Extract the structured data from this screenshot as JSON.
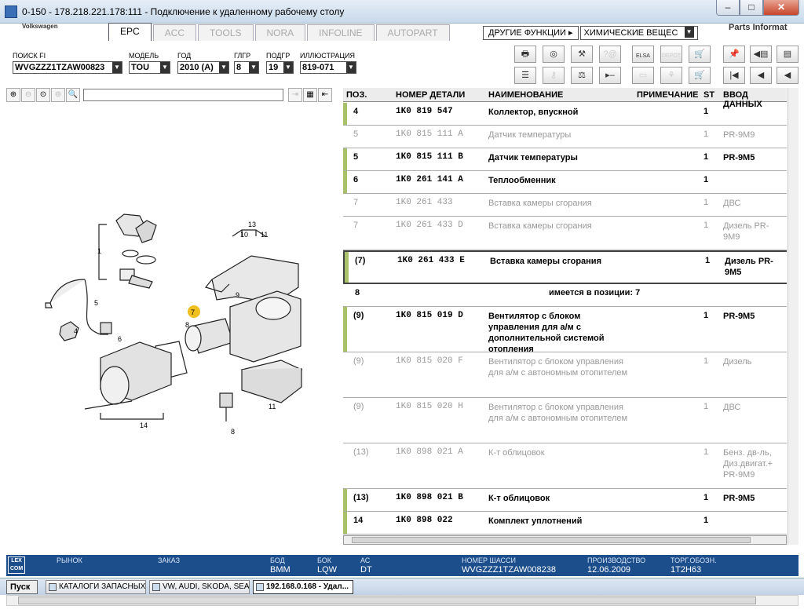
{
  "window": {
    "title": "0-150 - 178.218.221.178:111 - Подключение к удаленному рабочему столу",
    "min": "–",
    "max": "□",
    "close": "✕"
  },
  "app": {
    "brand": "Volkswagen",
    "parts_info": "Parts Informat"
  },
  "tabs": [
    {
      "label": "EPC",
      "active": true
    },
    {
      "label": "ACC"
    },
    {
      "label": "TOOLS"
    },
    {
      "label": "NORA"
    },
    {
      "label": "INFOLINE"
    },
    {
      "label": "AUTOPART"
    }
  ],
  "functions": {
    "other": "ДРУГИЕ ФУНКЦИИ ▸",
    "chem": "ХИМИЧЕСКИЕ ВЕЩЕС"
  },
  "filters": {
    "vin": {
      "label": "ПОИСК FI",
      "value": "WVGZZZ1TZAW00823"
    },
    "model": {
      "label": "МОДЕЛЬ",
      "value": "TOU"
    },
    "year": {
      "label": "ГОД",
      "value": "2010 (A)"
    },
    "mg": {
      "label": "ГЛГР",
      "value": "8"
    },
    "sg": {
      "label": "ПОДГР",
      "value": "19"
    },
    "ill": {
      "label": "ИЛЛЮСТРАЦИЯ",
      "value": "819-071"
    }
  },
  "toolbar": {
    "elsa": "ELSA",
    "depot": "DEPOT"
  },
  "table": {
    "headers": {
      "pos": "ПОЗ.",
      "pn": "НОМЕР ДЕТАЛИ",
      "name": "НАИМЕНОВАНИЕ",
      "note": "ПРИМЕЧАНИЕ",
      "st": "ST",
      "data": "ВВОД ДАННЫХ"
    },
    "rows": [
      {
        "pos": "4",
        "pn": "1K0 819 547",
        "name": "Коллектор, впускной",
        "st": "1",
        "data": ""
      },
      {
        "pos": "5",
        "pn": "1K0 815 111 A",
        "name": "Датчик температуры",
        "st": "1",
        "data": "PR-9M9"
      },
      {
        "pos": "5",
        "pn": "1K0 815 111 B",
        "name": "Датчик температуры",
        "st": "1",
        "data": "PR-9M5"
      },
      {
        "pos": "6",
        "pn": "1K0 261 141 A",
        "name": "Теплообменник",
        "st": "1",
        "data": ""
      },
      {
        "pos": "7",
        "pn": "1K0 261 433",
        "name": "Вставка камеры сгорания",
        "st": "1",
        "data": "ДВС"
      },
      {
        "pos": "7",
        "pn": "1K0 261 433 D",
        "name": "Вставка камеры сгорания",
        "st": "1",
        "data": "Дизель PR-9M9"
      },
      {
        "pos": "(7)",
        "pn": "1K0 261 433 E",
        "name": "Вставка камеры сгорания",
        "st": "1",
        "data": "Дизель PR-9M5"
      },
      {
        "pos": "8",
        "pn": "",
        "name": "имеется в позиции:  7",
        "st": "",
        "data": ""
      },
      {
        "pos": "(9)",
        "pn": "1K0 815 019 D",
        "name": "Вентилятор с блоком управления для а/м с дополнительной системой отопления",
        "st": "1",
        "data": "PR-9M5"
      },
      {
        "pos": "(9)",
        "pn": "1K0 815 020 F",
        "name": "Вентилятор с блоком управления для а/м с автономным отопителем",
        "st": "1",
        "data": "Дизель"
      },
      {
        "pos": "(9)",
        "pn": "1K0 815 020 H",
        "name": "Вентилятор с блоком управления для а/м с автономным отопителем",
        "st": "1",
        "data": "ДВС"
      },
      {
        "pos": "(13)",
        "pn": "1K0 898 021 A",
        "name": "К-т облицовок",
        "st": "1",
        "data": "Бенз. дв-ль, Диз.двигат.+ PR-9M9"
      },
      {
        "pos": "(13)",
        "pn": "1K0 898 021 B",
        "name": "К-т облицовок",
        "st": "1",
        "data": "PR-9M5"
      },
      {
        "pos": "14",
        "pn": "1K0 898 022",
        "name": "Комплект уплотнений",
        "st": "1",
        "data": ""
      }
    ]
  },
  "drawing_labels": [
    "13",
    "10",
    "11",
    "1",
    "5",
    "4",
    "7",
    "8",
    "9",
    "6",
    "11",
    "8",
    "14"
  ],
  "status": {
    "market": {
      "label": "РЫНОК",
      "value": ""
    },
    "order": {
      "label": "ЗАКАЗ",
      "value": ""
    },
    "bod": {
      "label": "БОД",
      "value": "BMM"
    },
    "box": {
      "label": "БОК",
      "value": "LQW"
    },
    "ac": {
      "label": "АС",
      "value": "DT"
    },
    "chassis": {
      "label": "НОМЕР ШАССИ",
      "value": "WVGZZZ1TZAW008238"
    },
    "prod": {
      "label": "ПРОИЗВОДСТВО",
      "value": "12.06.2009"
    },
    "trade": {
      "label": "ТОРГ.ОБОЗН.",
      "value": "1T2H63"
    },
    "logo": "LEX COM"
  },
  "taskbar": {
    "start": "Пуск",
    "tasks": [
      "КАТАЛОГИ ЗАПАСНЫХ ...",
      "VW, AUDI, SKODA, SEAT",
      "192.168.0.168 - Удал..."
    ]
  }
}
